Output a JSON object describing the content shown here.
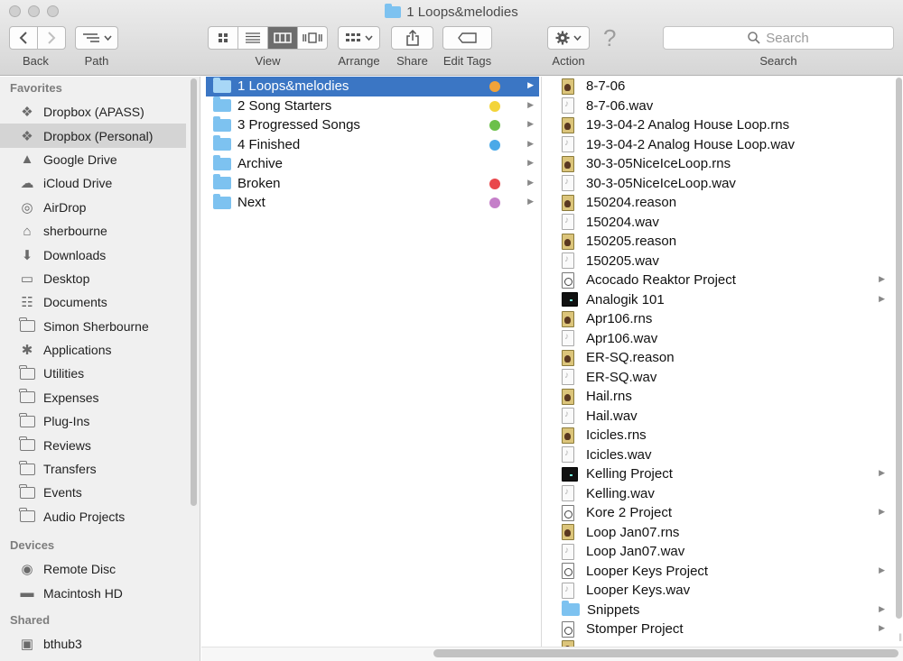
{
  "window": {
    "title": "1 Loops&melodies"
  },
  "toolbar": {
    "back_label": "Back",
    "path_label": "Path",
    "view_label": "View",
    "arrange_label": "Arrange",
    "share_label": "Share",
    "edit_tags_label": "Edit Tags",
    "action_label": "Action",
    "search_label": "Search",
    "search_placeholder": "Search",
    "help_glyph": "?"
  },
  "sidebar": {
    "favorites_header": "Favorites",
    "devices_header": "Devices",
    "shared_header": "Shared",
    "favorites": [
      {
        "label": "Dropbox (APASS)",
        "icon": "dropbox-icon"
      },
      {
        "label": "Dropbox (Personal)",
        "icon": "dropbox-icon",
        "selected": true
      },
      {
        "label": "Google Drive",
        "icon": "google-drive-icon"
      },
      {
        "label": "iCloud Drive",
        "icon": "cloud-icon"
      },
      {
        "label": "AirDrop",
        "icon": "airdrop-icon"
      },
      {
        "label": "sherbourne",
        "icon": "home-icon"
      },
      {
        "label": "Downloads",
        "icon": "downloads-icon"
      },
      {
        "label": "Desktop",
        "icon": "desktop-icon"
      },
      {
        "label": "Documents",
        "icon": "documents-icon"
      },
      {
        "label": "Simon Sherbourne",
        "icon": "folder-icon"
      },
      {
        "label": "Applications",
        "icon": "applications-icon"
      },
      {
        "label": "Utilities",
        "icon": "folder-icon"
      },
      {
        "label": "Expenses",
        "icon": "folder-icon"
      },
      {
        "label": "Plug-Ins",
        "icon": "folder-icon"
      },
      {
        "label": "Reviews",
        "icon": "folder-icon"
      },
      {
        "label": "Transfers",
        "icon": "folder-icon"
      },
      {
        "label": "Events",
        "icon": "folder-icon"
      },
      {
        "label": "Audio Projects",
        "icon": "folder-icon"
      }
    ],
    "devices": [
      {
        "label": "Remote Disc",
        "icon": "disc-icon"
      },
      {
        "label": "Macintosh HD",
        "icon": "hard-drive-icon"
      }
    ],
    "shared": [
      {
        "label": "bthub3",
        "icon": "computer-icon"
      }
    ]
  },
  "column1": [
    {
      "label": "1 Loops&melodies",
      "tag_color": "#f0a33a",
      "selected": true
    },
    {
      "label": "2 Song Starters",
      "tag_color": "#f3d43a"
    },
    {
      "label": "3 Progressed Songs",
      "tag_color": "#6cc04a"
    },
    {
      "label": "4 Finished",
      "tag_color": "#4aa9e8"
    },
    {
      "label": "Archive",
      "tag_color": ""
    },
    {
      "label": "Broken",
      "tag_color": "#e9484c"
    },
    {
      "label": "Next",
      "tag_color": "#c57fc9"
    }
  ],
  "column2": [
    {
      "label": "8-7-06",
      "kind": "rns",
      "folder": false
    },
    {
      "label": "8-7-06.wav",
      "kind": "wav",
      "folder": false
    },
    {
      "label": "19-3-04-2 Analog House Loop.rns",
      "kind": "rns",
      "folder": false
    },
    {
      "label": "19-3-04-2 Analog House Loop.wav",
      "kind": "wav",
      "folder": false
    },
    {
      "label": "30-3-05NiceIceLoop.rns",
      "kind": "rns",
      "folder": false
    },
    {
      "label": "30-3-05NiceIceLoop.wav",
      "kind": "wav",
      "folder": false
    },
    {
      "label": "150204.reason",
      "kind": "rns",
      "folder": false
    },
    {
      "label": "150204.wav",
      "kind": "wav",
      "folder": false
    },
    {
      "label": "150205.reason",
      "kind": "rns",
      "folder": false
    },
    {
      "label": "150205.wav",
      "kind": "wav",
      "folder": false
    },
    {
      "label": "Acocado Reaktor Project",
      "kind": "proj",
      "folder": true
    },
    {
      "label": "Analogik 101",
      "kind": "black",
      "folder": true
    },
    {
      "label": "Apr106.rns",
      "kind": "rns",
      "folder": false
    },
    {
      "label": "Apr106.wav",
      "kind": "wav",
      "folder": false
    },
    {
      "label": "ER-SQ.reason",
      "kind": "rns",
      "folder": false
    },
    {
      "label": "ER-SQ.wav",
      "kind": "wav",
      "folder": false
    },
    {
      "label": "Hail.rns",
      "kind": "rns",
      "folder": false
    },
    {
      "label": "Hail.wav",
      "kind": "wav",
      "folder": false
    },
    {
      "label": "Icicles.rns",
      "kind": "rns",
      "folder": false
    },
    {
      "label": "Icicles.wav",
      "kind": "wav",
      "folder": false
    },
    {
      "label": "Kelling Project",
      "kind": "black",
      "folder": true
    },
    {
      "label": "Kelling.wav",
      "kind": "wav",
      "folder": false
    },
    {
      "label": "Kore 2 Project",
      "kind": "proj",
      "folder": true
    },
    {
      "label": "Loop Jan07.rns",
      "kind": "rns",
      "folder": false
    },
    {
      "label": "Loop Jan07.wav",
      "kind": "wav",
      "folder": false
    },
    {
      "label": "Looper Keys Project",
      "kind": "proj",
      "folder": true
    },
    {
      "label": "Looper Keys.wav",
      "kind": "wav",
      "folder": false
    },
    {
      "label": "Snippets",
      "kind": "folder",
      "folder": true
    },
    {
      "label": "Stomper Project",
      "kind": "proj",
      "folder": true
    },
    {
      "label": "",
      "kind": "rns",
      "folder": false
    }
  ]
}
